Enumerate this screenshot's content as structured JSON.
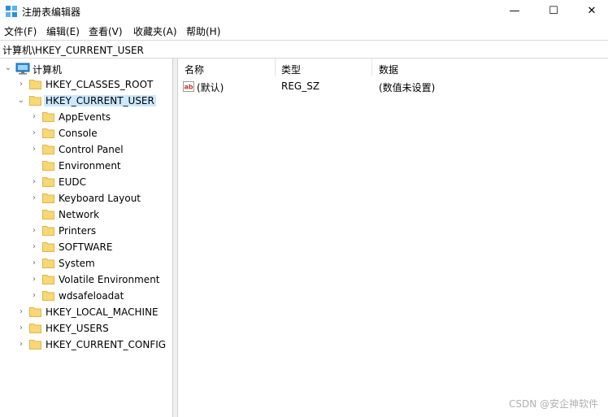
{
  "window": {
    "title": "注册表编辑器",
    "minimize": "—",
    "maximize": "☐",
    "close": "✕"
  },
  "menu": [
    "文件(F)",
    "编辑(E)",
    "查看(V)",
    "收藏夹(A)",
    "帮助(H)"
  ],
  "address": "计算机\\HKEY_CURRENT_USER",
  "tree": {
    "root": "计算机",
    "items": [
      {
        "label": "HKEY_CLASSES_ROOT",
        "level": 1,
        "expander": "collapsed"
      },
      {
        "label": "HKEY_CURRENT_USER",
        "level": 1,
        "expander": "expanded",
        "selected": true
      },
      {
        "label": "AppEvents",
        "level": 2,
        "expander": "collapsed"
      },
      {
        "label": "Console",
        "level": 2,
        "expander": "collapsed"
      },
      {
        "label": "Control Panel",
        "level": 2,
        "expander": "collapsed"
      },
      {
        "label": "Environment",
        "level": 2,
        "expander": "none"
      },
      {
        "label": "EUDC",
        "level": 2,
        "expander": "collapsed"
      },
      {
        "label": "Keyboard Layout",
        "level": 2,
        "expander": "collapsed"
      },
      {
        "label": "Network",
        "level": 2,
        "expander": "none"
      },
      {
        "label": "Printers",
        "level": 2,
        "expander": "collapsed"
      },
      {
        "label": "SOFTWARE",
        "level": 2,
        "expander": "collapsed"
      },
      {
        "label": "System",
        "level": 2,
        "expander": "collapsed"
      },
      {
        "label": "Volatile Environment",
        "level": 2,
        "expander": "collapsed"
      },
      {
        "label": "wdsafeloadat",
        "level": 2,
        "expander": "collapsed"
      },
      {
        "label": "HKEY_LOCAL_MACHINE",
        "level": 1,
        "expander": "collapsed"
      },
      {
        "label": "HKEY_USERS",
        "level": 1,
        "expander": "collapsed"
      },
      {
        "label": "HKEY_CURRENT_CONFIG",
        "level": 1,
        "expander": "collapsed"
      }
    ]
  },
  "list": {
    "columns": [
      "名称",
      "类型",
      "数据"
    ],
    "rows": [
      {
        "icon": "string-value-icon",
        "name": "(默认)",
        "type": "REG_SZ",
        "data": "(数值未设置)"
      }
    ]
  },
  "watermark": "CSDN @安企神软件",
  "colors": {
    "selection": "#cce8ff",
    "folder": "#f8d775",
    "folder_edge": "#e0b64b",
    "computer": "#2b8fd6"
  }
}
